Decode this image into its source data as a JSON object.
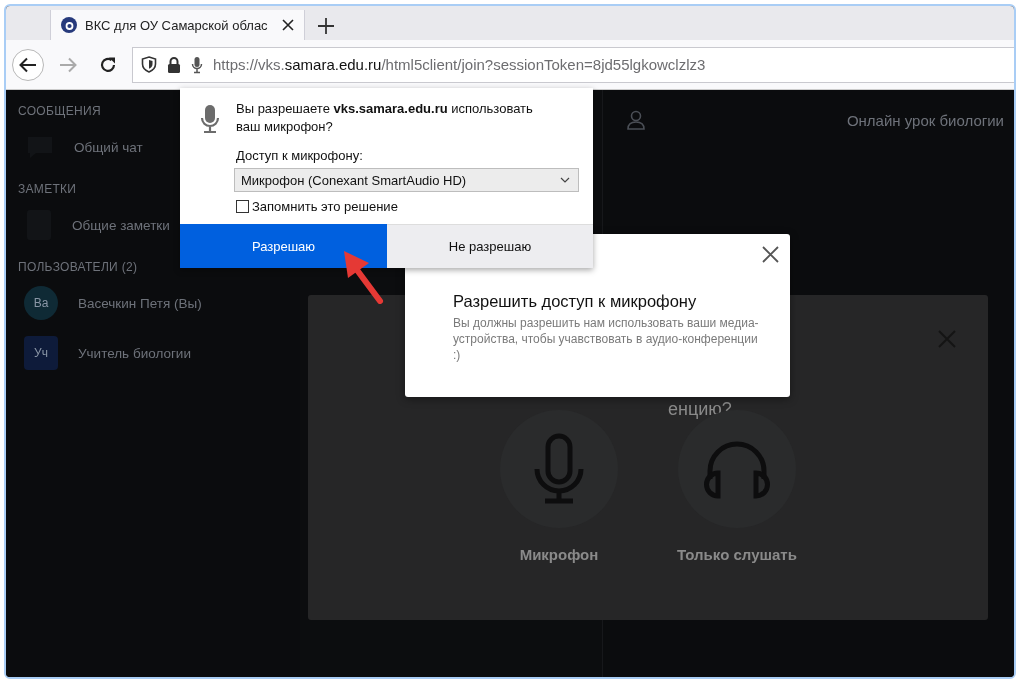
{
  "browser": {
    "tabs": [
      {
        "title": "ВКС для ОУ Самарской облас",
        "selected": true
      }
    ],
    "url": {
      "prefix": "https://vks.",
      "domain": "samara.edu.ru",
      "path": "/html5client/join?sessionToken=8jd55lgkowclzlz3"
    }
  },
  "sidebar": {
    "sections": [
      {
        "heading": "СООБЩЕНИЯ",
        "items": [
          {
            "label": "Общий чат",
            "kind": "chat"
          }
        ]
      },
      {
        "heading": "ЗАМЕТКИ",
        "items": [
          {
            "label": "Общие заметки",
            "kind": "notes"
          }
        ]
      },
      {
        "heading": "ПОЛЬЗОВАТЕЛИ (2)",
        "items": [
          {
            "label": "Васечкин Петя (Вы)",
            "kind": "user",
            "avatar": "Ва",
            "moderator": false,
            "color": "#0f2a35"
          },
          {
            "label": "Учитель биологии",
            "kind": "user",
            "avatar": "Уч",
            "moderator": true,
            "color": "#0e1b3a"
          }
        ]
      }
    ]
  },
  "meeting": {
    "title": "Онлайн урок биологии"
  },
  "audio_modal": {
    "title_fragment": "енцию?",
    "options": [
      {
        "label": "Микрофон",
        "kind": "microphone"
      },
      {
        "label": "Только слушать",
        "kind": "headphones"
      }
    ]
  },
  "permission_prompt": {
    "question": "Вы разрешаете **vks.samara.edu.ru** использовать ваш микрофон?",
    "device_label": "Доступ к микрофону:",
    "device": "Микрофон (Conexant SmartAudio HD)",
    "remember": {
      "label": "Запомнить это решение",
      "checked": false
    },
    "buttons": [
      {
        "label": "Разрешаю",
        "kind": "primary"
      },
      {
        "label": "Не разрешаю",
        "kind": "secondary"
      }
    ]
  },
  "notice": {
    "title": "Разрешить доступ к микрофону",
    "text": "Вы должны разрешить нам использовать ваши медиа-устройства, чтобы учавствовать в аудио-конференции :)"
  }
}
